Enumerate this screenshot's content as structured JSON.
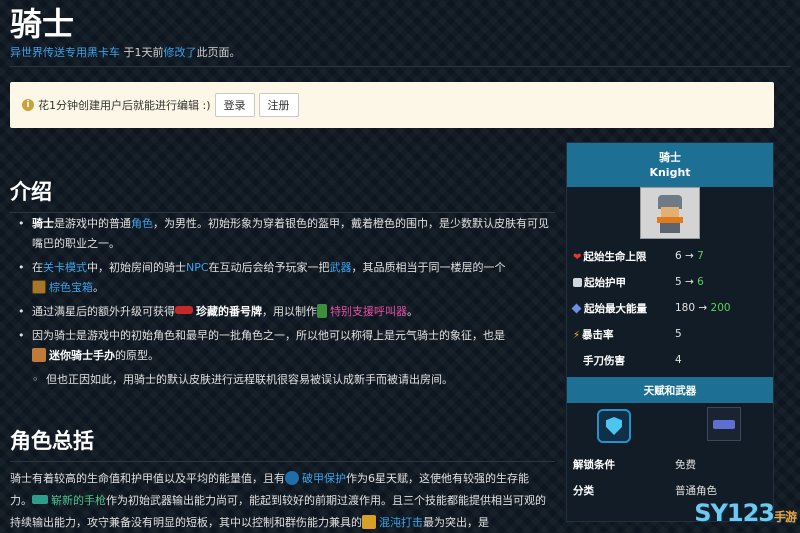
{
  "header": {
    "title": "骑士",
    "editor": "异世界传送专用黑卡车",
    "when": " 于1天前",
    "action": "修改了",
    "suffix": "此页面。"
  },
  "notice": {
    "text": "花1分钟创建用户后就能进行编辑 :)",
    "login_label": "登录",
    "register_label": "注册"
  },
  "sections": {
    "intro": "介绍",
    "summary": "角色总括"
  },
  "intro_items": [
    {
      "a": "骑士",
      "b": "是游戏中的普通",
      "c": "角色",
      "d": "，为男性。初始形象为穿着银色的盔甲，戴着橙色的围巾，是少数默认皮肤有可见嘴巴的职业之一。"
    },
    {
      "a": "在",
      "b": "关卡模式",
      "c": "中，初始房间的骑士",
      "d": "NPC",
      "e": "在互动后会给予玩家一把",
      "f": "武器",
      "g": "，其品质相当于同一楼层的一个",
      "h": "棕色宝箱",
      "i": "。"
    },
    {
      "a": "通过满星后的额外升级可获得",
      "b": "珍藏的番号牌",
      "c": "，用以制作",
      "d": "特别支援呼叫器",
      "e": "。"
    },
    {
      "a": "因为骑士是游戏中的初始角色和最早的一批角色之一，所以他可以称得上是元气骑士的象征，也是",
      "b": "迷你骑士手办",
      "c": "的原型。"
    },
    {
      "a": "但也正因如此，用骑士的默认皮肤进行远程联机很容易被误认成新手而被请出房间。"
    }
  ],
  "summary_para": {
    "a": "骑士有着较高的生命值和护甲值以及平均的能量值，且有",
    "b": "破甲保护",
    "c": "作为6星天赋，这使他有较强的生存能力。",
    "d": "崭新的手枪",
    "e": "作为初始武器输出能力尚可，能起到较好的前期过渡作用。且三个技能都能提供相当可观的持续输出能力，攻守兼备没有明显的短板，其中以控制和群伤能力兼具的",
    "f": "混沌打击",
    "g": "最为突出，是"
  },
  "infobox": {
    "name": "骑士",
    "name_en": "Knight",
    "stats": [
      {
        "label": "起始生命上限",
        "base": "6",
        "arrow": " → ",
        "max": "7",
        "icon": "heart-icon"
      },
      {
        "label": "起始护甲",
        "base": "5",
        "arrow": " → ",
        "max": "6",
        "icon": "armor-icon"
      },
      {
        "label": "起始最大能量",
        "base": "180",
        "arrow": " → ",
        "max": "200",
        "icon": "energy-icon"
      },
      {
        "label": "暴击率",
        "base": "5",
        "icon": "crit-icon"
      },
      {
        "label": "手刀伤害",
        "base": "4"
      }
    ],
    "talent_header": "天赋和武器",
    "unlock_label": "解锁条件",
    "unlock_value": "免费",
    "category_label": "分类",
    "category_value": "普通角色"
  },
  "watermark": {
    "main": "SY123",
    "small": "手游"
  },
  "colors": {
    "accent": "#1d6f93",
    "link": "#3ba3e8",
    "pink": "#e64fa6",
    "up": "#4fd35a",
    "notice_bg": "#fcf7e6"
  }
}
